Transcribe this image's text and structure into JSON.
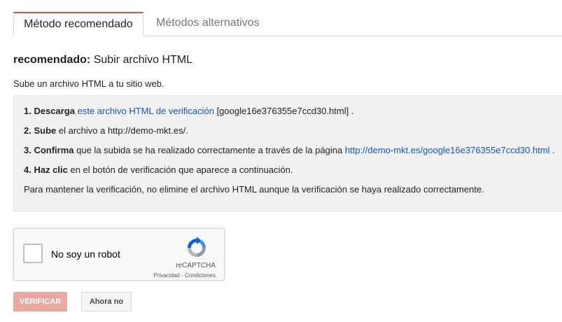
{
  "tabs": {
    "recommended": "Método recomendado",
    "alternative": "Métodos alternativos"
  },
  "heading": {
    "bold": "recomendado:",
    "text": " Subir archivo HTML"
  },
  "intro": "Sube un archivo HTML a tu sitio web.",
  "steps": {
    "s1": {
      "num": "1. Descarga",
      "link": "este archivo HTML de verificación",
      "file": " [google16e376355e7ccd30.html] ."
    },
    "s2": {
      "num": "2. Sube",
      "text": " el archivo a http://demo-mkt.es/."
    },
    "s3": {
      "num": "3. Confirma",
      "text": " que la subida se ha realizado correctamente a través de la página ",
      "link": "http://demo-mkt.es/google16e376355e7ccd30.html",
      "end": " ."
    },
    "s4": {
      "num": "4. Haz clic",
      "text": " en el botón de verificación que aparece a continuación."
    },
    "s5": {
      "text": "Para mantener la verificación, no elimine el archivo HTML aunque la verificación se haya realizado correctamente."
    }
  },
  "recaptcha": {
    "label": "No soy un robot",
    "brand": "reCAPTCHA",
    "links": "Privacidad - Condiciones"
  },
  "buttons": {
    "verify": "VERIFICAR",
    "later": "Ahora no"
  },
  "colors": {
    "accent_tab": "#dd4b39",
    "link": "#1155cc",
    "verify_disabled": "#e8a9a3"
  }
}
